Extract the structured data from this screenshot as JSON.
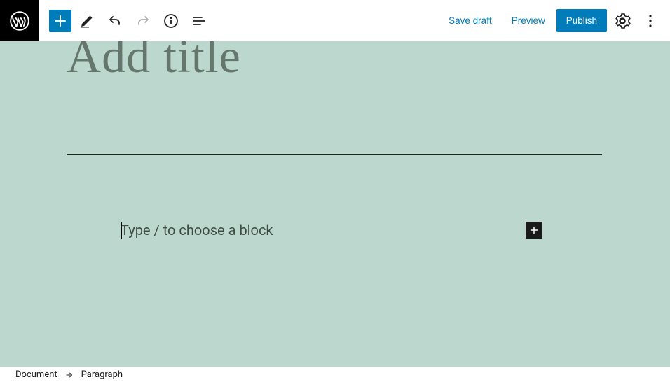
{
  "toolbar": {
    "save_draft": "Save draft",
    "preview": "Preview",
    "publish": "Publish"
  },
  "editor": {
    "title_placeholder": "Add title",
    "block_placeholder": "Type / to choose a block"
  },
  "breadcrumb": {
    "root": "Document",
    "current": "Paragraph"
  }
}
